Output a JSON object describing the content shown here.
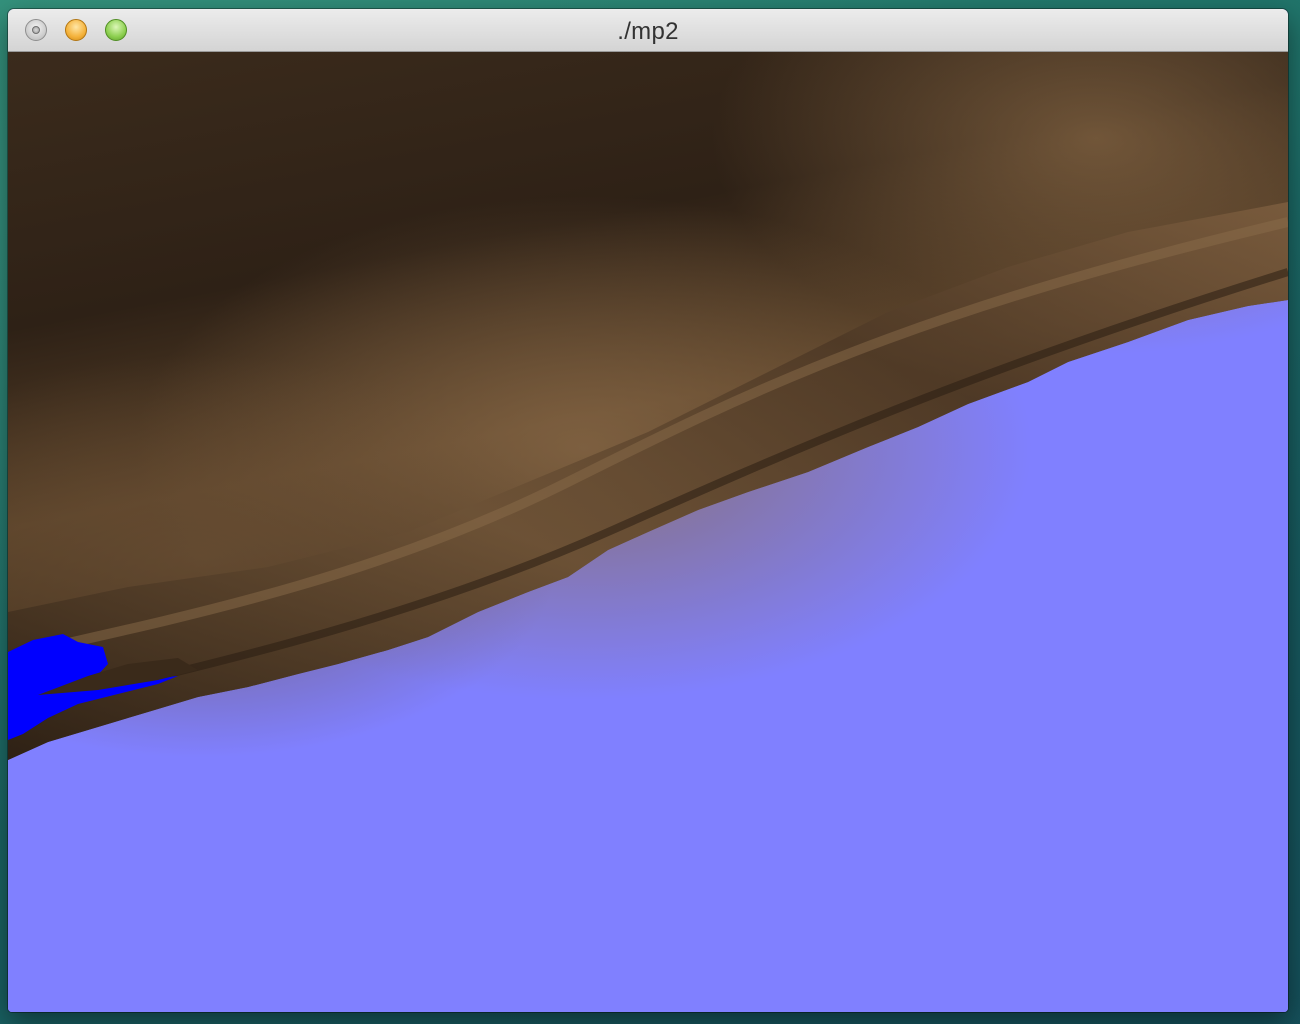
{
  "window": {
    "title": "./mp2"
  },
  "colors": {
    "sky": "#8080ff",
    "water": "#0000ff",
    "terrain_dark": "#2f2317",
    "terrain_light": "#7a5b3d"
  },
  "icons": {
    "close": "close-button-icon",
    "minimize": "minimize-button-icon",
    "zoom": "zoom-button-icon"
  }
}
